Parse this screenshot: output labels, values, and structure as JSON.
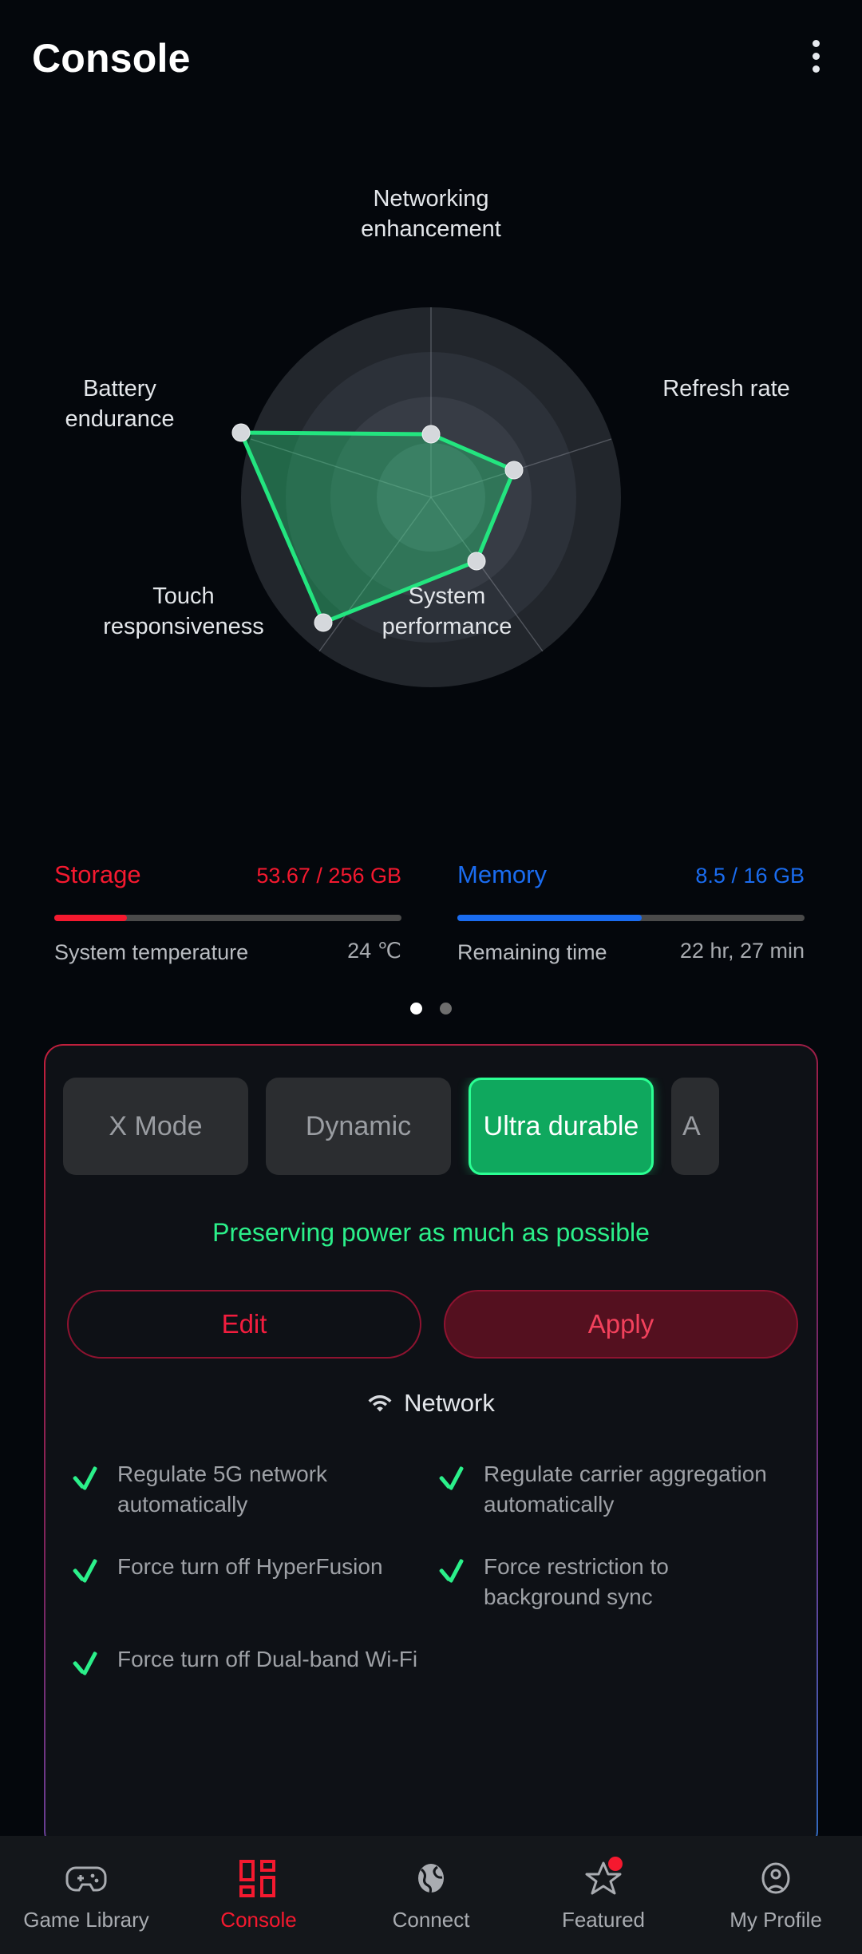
{
  "header": {
    "title": "Console",
    "menu_icon": "kebab-menu-icon"
  },
  "chart_data": {
    "type": "radar",
    "title": "",
    "categories": [
      "Networking\nenhancement",
      "Refresh rate",
      "System\nperformance",
      "Touch\nresponsiveness",
      "Battery\nendurance"
    ],
    "values": [
      33,
      44,
      41,
      82,
      100
    ],
    "ylim": [
      0,
      100
    ],
    "rings": 4,
    "grid": true,
    "legend": "none",
    "series": [
      {
        "name": "Ultra durable profile",
        "values": [
          33,
          44,
          41,
          82,
          100
        ]
      }
    ],
    "accent_color": "#23e57f"
  },
  "stats": {
    "storage": {
      "name": "Storage",
      "value": "53.67 / 256 GB",
      "percent": 21,
      "color": "#f5192f",
      "sub_label": "System temperature",
      "sub_value": "24 ℃"
    },
    "memory": {
      "name": "Memory",
      "value": "8.5 / 16 GB",
      "percent": 53,
      "color": "#1a6cf0",
      "sub_label": "Remaining time",
      "sub_value": "22 hr, 27 min"
    },
    "pager": {
      "total": 2,
      "active": 0
    }
  },
  "panel": {
    "modes": [
      {
        "label": "X Mode",
        "selected": false
      },
      {
        "label": "Dynamic",
        "selected": false
      },
      {
        "label": "Ultra durable",
        "selected": true
      },
      {
        "label": "A",
        "selected": false,
        "partial": true
      }
    ],
    "tagline": "Preserving power as much as possible",
    "buttons": {
      "edit": "Edit",
      "apply": "Apply"
    },
    "section": {
      "icon": "wifi-icon",
      "title": "Network"
    },
    "checklist": [
      "Regulate 5G network automatically",
      "Regulate carrier aggregation automatically",
      "Force turn off HyperFusion",
      "Force restriction to background sync",
      "Force turn off Dual-band Wi-Fi"
    ],
    "border_colors": [
      "#c01f3c",
      "#7a2560",
      "#2f6bc0"
    ]
  },
  "nav": {
    "items": [
      {
        "label": "Game Library",
        "icon": "gamepad-icon",
        "active": false,
        "badge": false
      },
      {
        "label": "Console",
        "icon": "grid-icon",
        "active": true,
        "badge": false
      },
      {
        "label": "Connect",
        "icon": "globe-icon",
        "active": false,
        "badge": false
      },
      {
        "label": "Featured",
        "icon": "star-icon",
        "active": false,
        "badge": true
      },
      {
        "label": "My Profile",
        "icon": "profile-icon",
        "active": false,
        "badge": false
      }
    ],
    "active_color": "#f5192f"
  }
}
